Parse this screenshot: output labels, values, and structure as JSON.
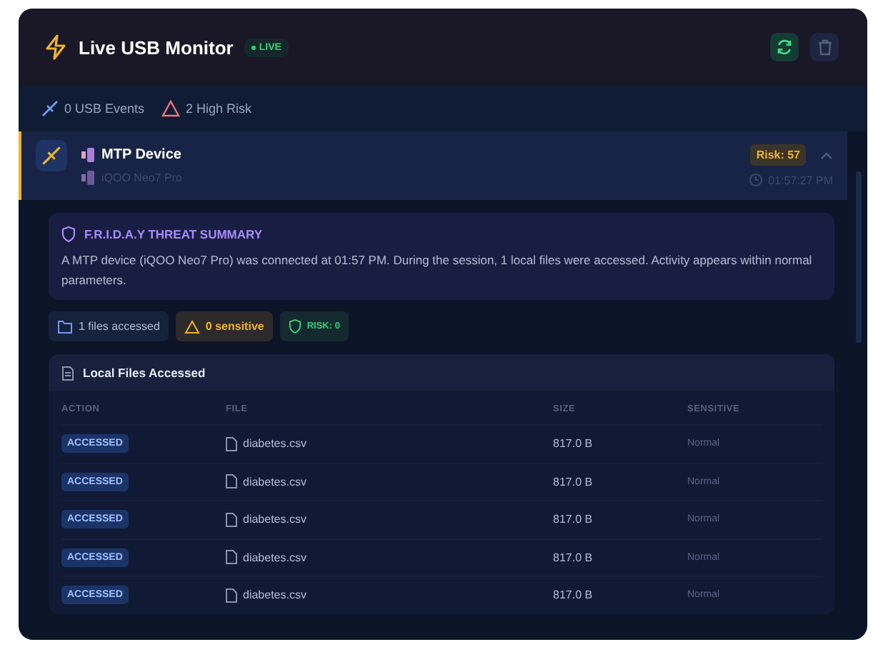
{
  "header": {
    "title": "Live USB Monitor",
    "live_badge": "LIVE"
  },
  "stats": {
    "events": "0 USB Events",
    "high_risk": "2 High Risk"
  },
  "device": {
    "name": "MTP Device",
    "model": "iQOO Neo7 Pro",
    "risk": "Risk: 57",
    "time": "01:57:27 PM",
    "expanded": true,
    "summary": {
      "title": "F.R.I.D.A.Y THREAT SUMMARY",
      "text": "A MTP device (iQOO Neo7 Pro) was connected at 01:57 PM. During the session, 1 local files were accessed. Activity appears within normal parameters."
    },
    "chips": [
      {
        "kind": "files",
        "label": "1 files accessed"
      },
      {
        "kind": "sensitive",
        "label": "0 sensitive"
      },
      {
        "kind": "risk",
        "label": "RISK: 0"
      }
    ],
    "files": {
      "title": "Local Files Accessed",
      "columns": [
        "ACTION",
        "FILE",
        "SIZE",
        "SENSITIVE"
      ],
      "rows": [
        {
          "action": "ACCESSED",
          "file": "diabetes.csv",
          "size": "817.0 B",
          "sensitive": "Normal"
        },
        {
          "action": "ACCESSED",
          "file": "diabetes.csv",
          "size": "817.0 B",
          "sensitive": "Normal"
        },
        {
          "action": "ACCESSED",
          "file": "diabetes.csv",
          "size": "817.0 B",
          "sensitive": "Normal"
        },
        {
          "action": "ACCESSED",
          "file": "diabetes.csv",
          "size": "817.0 B",
          "sensitive": "Normal"
        },
        {
          "action": "ACCESSED",
          "file": "diabetes.csv",
          "size": "817.0 B",
          "sensitive": "Normal"
        }
      ]
    }
  }
}
